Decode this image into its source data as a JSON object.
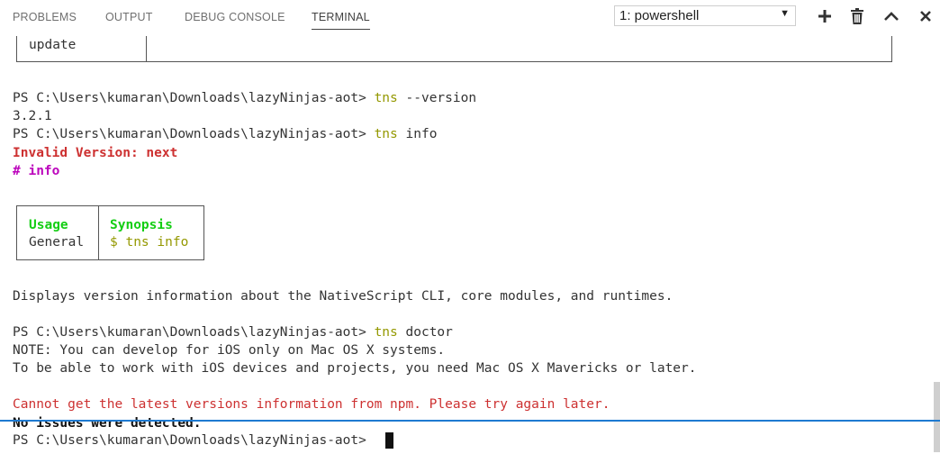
{
  "panel": {
    "tabs": [
      {
        "label": "PROBLEMS"
      },
      {
        "label": "OUTPUT"
      },
      {
        "label": "DEBUG CONSOLE"
      },
      {
        "label": "TERMINAL",
        "active": true
      }
    ],
    "terminal_select": {
      "value": "1: powershell"
    },
    "actions": [
      "plus-icon",
      "trash-icon",
      "chevron-up-icon",
      "close-icon"
    ]
  },
  "terminal": {
    "top_table_cell": "update",
    "lines": {
      "l1_prompt": "PS C:\\Users\\kumaran\\Downloads\\lazyNinjas-aot> ",
      "l1_cmd": "tns",
      "l1_args": " --version",
      "l2": "3.2.1",
      "l3_prompt": "PS C:\\Users\\kumaran\\Downloads\\lazyNinjas-aot> ",
      "l3_cmd": "tns",
      "l3_args": " info",
      "l4": "Invalid Version: next",
      "l5": "# info",
      "l6": "Displays version information about the NativeScript CLI, core modules, and runtimes.",
      "l7_prompt": "PS C:\\Users\\kumaran\\Downloads\\lazyNinjas-aot> ",
      "l7_cmd": "tns",
      "l7_args": " doctor",
      "l8": "NOTE: You can develop for iOS only on Mac OS X systems.",
      "l9": "To be able to work with iOS devices and projects, you need Mac OS X Mavericks or later.",
      "l10": "Cannot get the latest versions information from npm. Please try again later.",
      "l11": "No issues were detected.",
      "l12_prompt": "PS C:\\Users\\kumaran\\Downloads\\lazyNinjas-aot> "
    },
    "info_table": {
      "headers": [
        "Usage",
        "Synopsis"
      ],
      "row": [
        "General",
        "$ tns info"
      ]
    }
  },
  "colors": {
    "command": "#949800",
    "error": "#cd3131",
    "heading": "#bc05bc",
    "table_header": "#14ce14"
  }
}
